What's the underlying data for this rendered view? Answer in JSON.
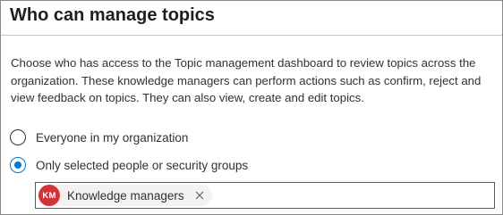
{
  "panel": {
    "title": "Who can manage topics",
    "description": "Choose who has access to the Topic management dashboard to review topics across the organization. These knowledge managers can perform actions such as confirm, reject and view feedback on topics. They can also view, create and edit topics."
  },
  "options": [
    {
      "label": "Everyone in my organization",
      "selected": false
    },
    {
      "label": "Only selected people or security groups",
      "selected": true
    }
  ],
  "picker": {
    "chips": [
      {
        "initials": "KM",
        "label": "Knowledge managers",
        "avatar_color": "#d13438"
      }
    ],
    "input_value": ""
  },
  "colors": {
    "accent": "#0078d4",
    "avatar": "#d13438",
    "text": "#323130"
  },
  "icons": {
    "chip_remove": "close-icon"
  }
}
